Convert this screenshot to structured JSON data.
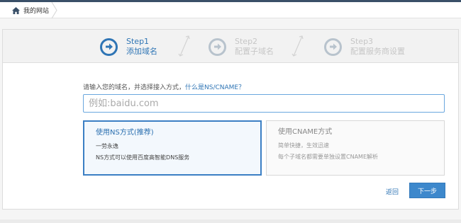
{
  "breadcrumb": {
    "home_label": "我的网站"
  },
  "wizard": {
    "steps": [
      {
        "num": "Step1",
        "title": "添加域名",
        "state": "active"
      },
      {
        "num": "Step2",
        "title": "配置子域名",
        "state": "pending"
      },
      {
        "num": "Step3",
        "title": "配置服务商设置",
        "state": "pending"
      }
    ]
  },
  "form": {
    "prompt": "请输入您的域名，并选择接入方式，",
    "help_link": "什么是NS/CNAME？",
    "domain_input": {
      "value": "",
      "placeholder": "例如:baidu.com"
    }
  },
  "options": {
    "ns": {
      "title": "使用NS方式(推荐)",
      "desc1": "一劳永逸",
      "desc2": "NS方式可以使用百度高智能DNS服务",
      "selected": true
    },
    "cname": {
      "title": "使用CNAME方式",
      "desc1": "简单快捷，生效迅速",
      "desc2": "每个子域名都需要单独设置CNAME解析",
      "selected": false
    }
  },
  "actions": {
    "back_label": "返回",
    "next_label": "下一步"
  },
  "colors": {
    "accent": "#2f75b5",
    "topbar": "#3a5068",
    "inactive": "#c6c6c6"
  }
}
